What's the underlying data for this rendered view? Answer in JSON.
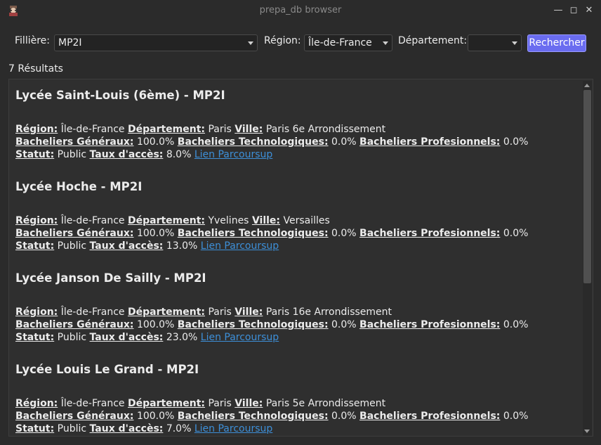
{
  "window": {
    "title": "prepa_db browser"
  },
  "filters": {
    "filiere_label": "Fillière:",
    "filiere_value": "MP2I",
    "region_label": "Région:",
    "region_value": "Île-de-France",
    "departement_label": "Département:",
    "departement_value": "",
    "search_label": "Rechercher"
  },
  "results_count": "7 Résultats",
  "labels": {
    "region": "Région:",
    "departement": "Département:",
    "ville": "Ville:",
    "generaux": "Bacheliers Généraux:",
    "techno": "Bacheliers Technologiques:",
    "pro": "Bacheliers Profesionnels:",
    "statut": "Statut:",
    "taux": "Taux d'accès:",
    "link": "Lien Parcoursup"
  },
  "results": [
    {
      "title": "Lycée Saint-Louis (6ème) - MP2I",
      "region": "Île-de-France",
      "departement": "Paris",
      "ville": "Paris 6e Arrondissement",
      "generaux": "100.0%",
      "techno": "0.0%",
      "pro": "0.0%",
      "statut": "Public",
      "taux": "8.0%"
    },
    {
      "title": "Lycée Hoche - MP2I",
      "region": "Île-de-France",
      "departement": "Yvelines",
      "ville": "Versailles",
      "generaux": "100.0%",
      "techno": "0.0%",
      "pro": "0.0%",
      "statut": "Public",
      "taux": "13.0%"
    },
    {
      "title": "Lycée Janson De Sailly - MP2I",
      "region": "Île-de-France",
      "departement": "Paris",
      "ville": "Paris 16e Arrondissement",
      "generaux": "100.0%",
      "techno": "0.0%",
      "pro": "0.0%",
      "statut": "Public",
      "taux": "23.0%"
    },
    {
      "title": "Lycée Louis Le Grand - MP2I",
      "region": "Île-de-France",
      "departement": "Paris",
      "ville": "Paris 5e Arrondissement",
      "generaux": "100.0%",
      "techno": "0.0%",
      "pro": "0.0%",
      "statut": "Public",
      "taux": "7.0%"
    }
  ]
}
